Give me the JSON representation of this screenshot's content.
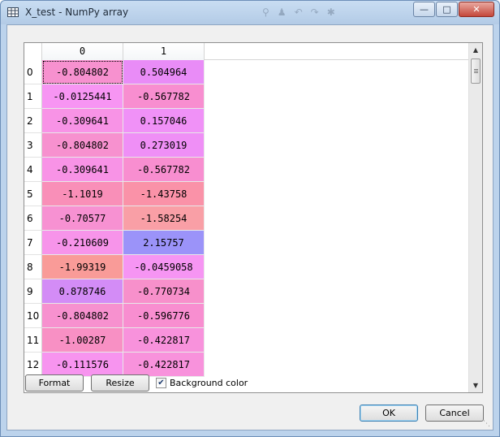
{
  "window": {
    "title": "X_test - NumPy array",
    "icon": "table-grid-icon",
    "caption_buttons": [
      "minimize",
      "maximize",
      "close"
    ]
  },
  "table": {
    "columns": [
      "0",
      "1"
    ],
    "rows": [
      {
        "index": "0",
        "values": [
          "-0.804802",
          "0.504964"
        ],
        "colors": [
          "#f791cf",
          "#e98cf7"
        ]
      },
      {
        "index": "1",
        "values": [
          "-0.0125441",
          "-0.567782"
        ],
        "colors": [
          "#f795f3",
          "#f88ed0"
        ]
      },
      {
        "index": "2",
        "values": [
          "-0.309641",
          "0.157046"
        ],
        "colors": [
          "#f893e6",
          "#f091f7"
        ]
      },
      {
        "index": "3",
        "values": [
          "-0.804802",
          "0.273019"
        ],
        "colors": [
          "#f791cf",
          "#ef8ff6"
        ]
      },
      {
        "index": "4",
        "values": [
          "-0.309641",
          "-0.567782"
        ],
        "colors": [
          "#f893e6",
          "#f88ed0"
        ]
      },
      {
        "index": "5",
        "values": [
          "-1.1019",
          "-1.43758"
        ],
        "colors": [
          "#f98fb8",
          "#fa92a8"
        ]
      },
      {
        "index": "6",
        "values": [
          "-0.70577",
          "-1.58254"
        ],
        "colors": [
          "#f791d2",
          "#f99fa6"
        ]
      },
      {
        "index": "7",
        "values": [
          "-0.210609",
          "2.15757"
        ],
        "colors": [
          "#f794ea",
          "#9b93f9"
        ]
      },
      {
        "index": "8",
        "values": [
          "-1.99319",
          "-0.0459058"
        ],
        "colors": [
          "#f99b98",
          "#f695f3"
        ]
      },
      {
        "index": "9",
        "values": [
          "0.878746",
          "-0.770734"
        ],
        "colors": [
          "#d38cf6",
          "#f790cb"
        ]
      },
      {
        "index": "10",
        "values": [
          "-0.804802",
          "-0.596776"
        ],
        "colors": [
          "#f791cf",
          "#f88ed0"
        ]
      },
      {
        "index": "11",
        "values": [
          "-1.00287",
          "-0.422817"
        ],
        "colors": [
          "#f890c4",
          "#f892dc"
        ]
      },
      {
        "index": "12",
        "values": [
          "-0.111576",
          "-0.422817"
        ],
        "colors": [
          "#f794ef",
          "#f892dc"
        ]
      }
    ],
    "selected_cell": {
      "row": 0,
      "col": 0
    }
  },
  "controls": {
    "format_label": "Format",
    "resize_label": "Resize",
    "background_color_label": "Background color",
    "background_color_checked": true,
    "ok_label": "OK",
    "cancel_label": "Cancel"
  }
}
